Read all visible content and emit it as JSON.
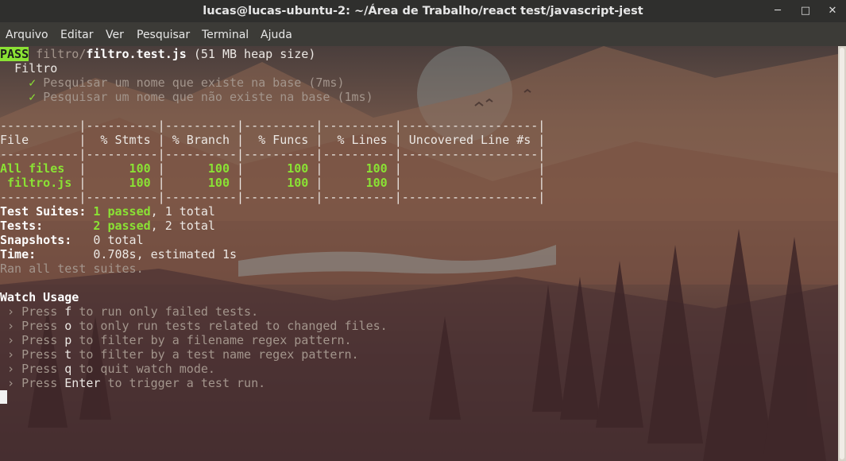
{
  "window": {
    "title": "lucas@lucas-ubuntu-2: ~/Área de Trabalho/react test/javascript-jest",
    "minimize": "─",
    "maximize": "□",
    "close": "✕"
  },
  "menu": [
    "Arquivo",
    "Editar",
    "Ver",
    "Pesquisar",
    "Terminal",
    "Ajuda"
  ],
  "colors": {
    "pass_bg": "#8ae234",
    "green": "#8ae234",
    "titlebar": "#2f2f2d",
    "menubar": "#3c3b37"
  },
  "terminal": {
    "pass_badge": "PASS",
    "file_dir": "filtro/",
    "file_name": "filtro.test.js",
    "heap": "(51 MB heap size)",
    "suite": "Filtro",
    "tests": [
      {
        "check": "✓",
        "name": "Pesquisar um nome que existe na base (7ms)"
      },
      {
        "check": "✓",
        "name": "Pesquisar um nome que não existe na base (1ms)"
      }
    ],
    "coverage": {
      "sep": "-----------|----------|----------|----------|----------|-------------------|",
      "header": "File       |  % Stmts | % Branch |  % Funcs |  % Lines | Uncovered Line #s |",
      "rows": [
        {
          "name": "All files  ",
          "stmts": "      100",
          "branch": "      100",
          "funcs": "      100",
          "lines": "      100"
        },
        {
          "name": " filtro.js ",
          "stmts": "      100",
          "branch": "      100",
          "funcs": "      100",
          "lines": "      100"
        }
      ]
    },
    "summary": {
      "suites_label": "Test Suites:",
      "suites_passed": "1 passed",
      "suites_total": ", 1 total",
      "tests_label": "Tests:",
      "tests_passed": "2 passed",
      "tests_total": ", 2 total",
      "snapshots_label": "Snapshots:",
      "snapshots_value": "0 total",
      "time_label": "Time:",
      "time_value": "0.708s, estimated 1s",
      "ran": "Ran all test suites."
    },
    "watch": {
      "title": "Watch Usage",
      "items": [
        {
          "pre": " › Press ",
          "key": "f",
          "post": " to run only failed tests."
        },
        {
          "pre": " › Press ",
          "key": "o",
          "post": " to only run tests related to changed files."
        },
        {
          "pre": " › Press ",
          "key": "p",
          "post": " to filter by a filename regex pattern."
        },
        {
          "pre": " › Press ",
          "key": "t",
          "post": " to filter by a test name regex pattern."
        },
        {
          "pre": " › Press ",
          "key": "q",
          "post": " to quit watch mode."
        },
        {
          "pre": " › Press ",
          "key": "Enter",
          "post": " to trigger a test run."
        }
      ]
    }
  }
}
